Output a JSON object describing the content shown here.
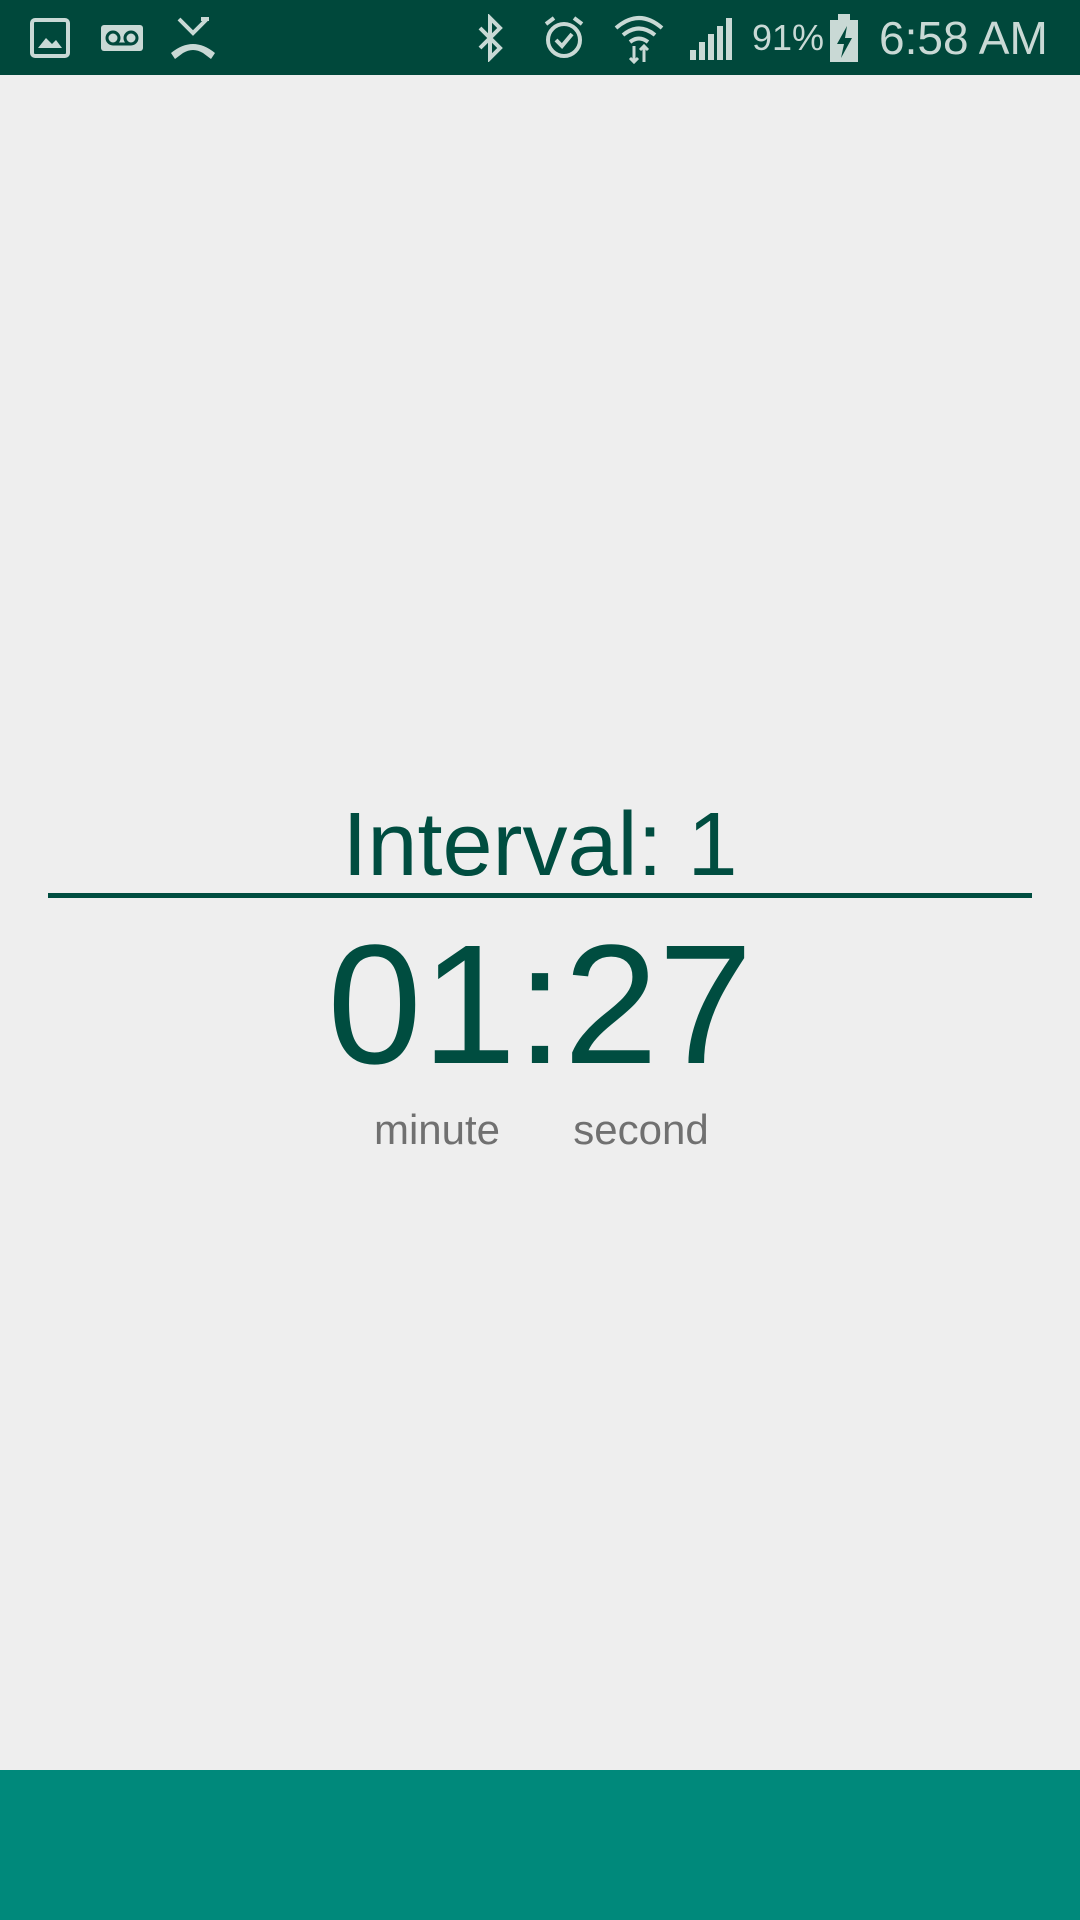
{
  "status_bar": {
    "icons_left": [
      "gallery-icon",
      "voicemail-icon",
      "missed-call-icon"
    ],
    "icons_right": [
      "bluetooth-icon",
      "alarm-icon",
      "wifi-icon",
      "signal-icon",
      "battery-charging-icon"
    ],
    "battery_percent": "91%",
    "time": "6:58 AM",
    "background_color": "#00483b",
    "icon_color": "#c9d9d5"
  },
  "timer": {
    "interval_label": "Interval: 1",
    "time_display": "01:27",
    "minute_label": "minute",
    "second_label": "second",
    "text_color": "#004d40",
    "label_color": "#707070"
  },
  "bottom_bar": {
    "color": "#00897b"
  },
  "page_background": "#eeeeee"
}
